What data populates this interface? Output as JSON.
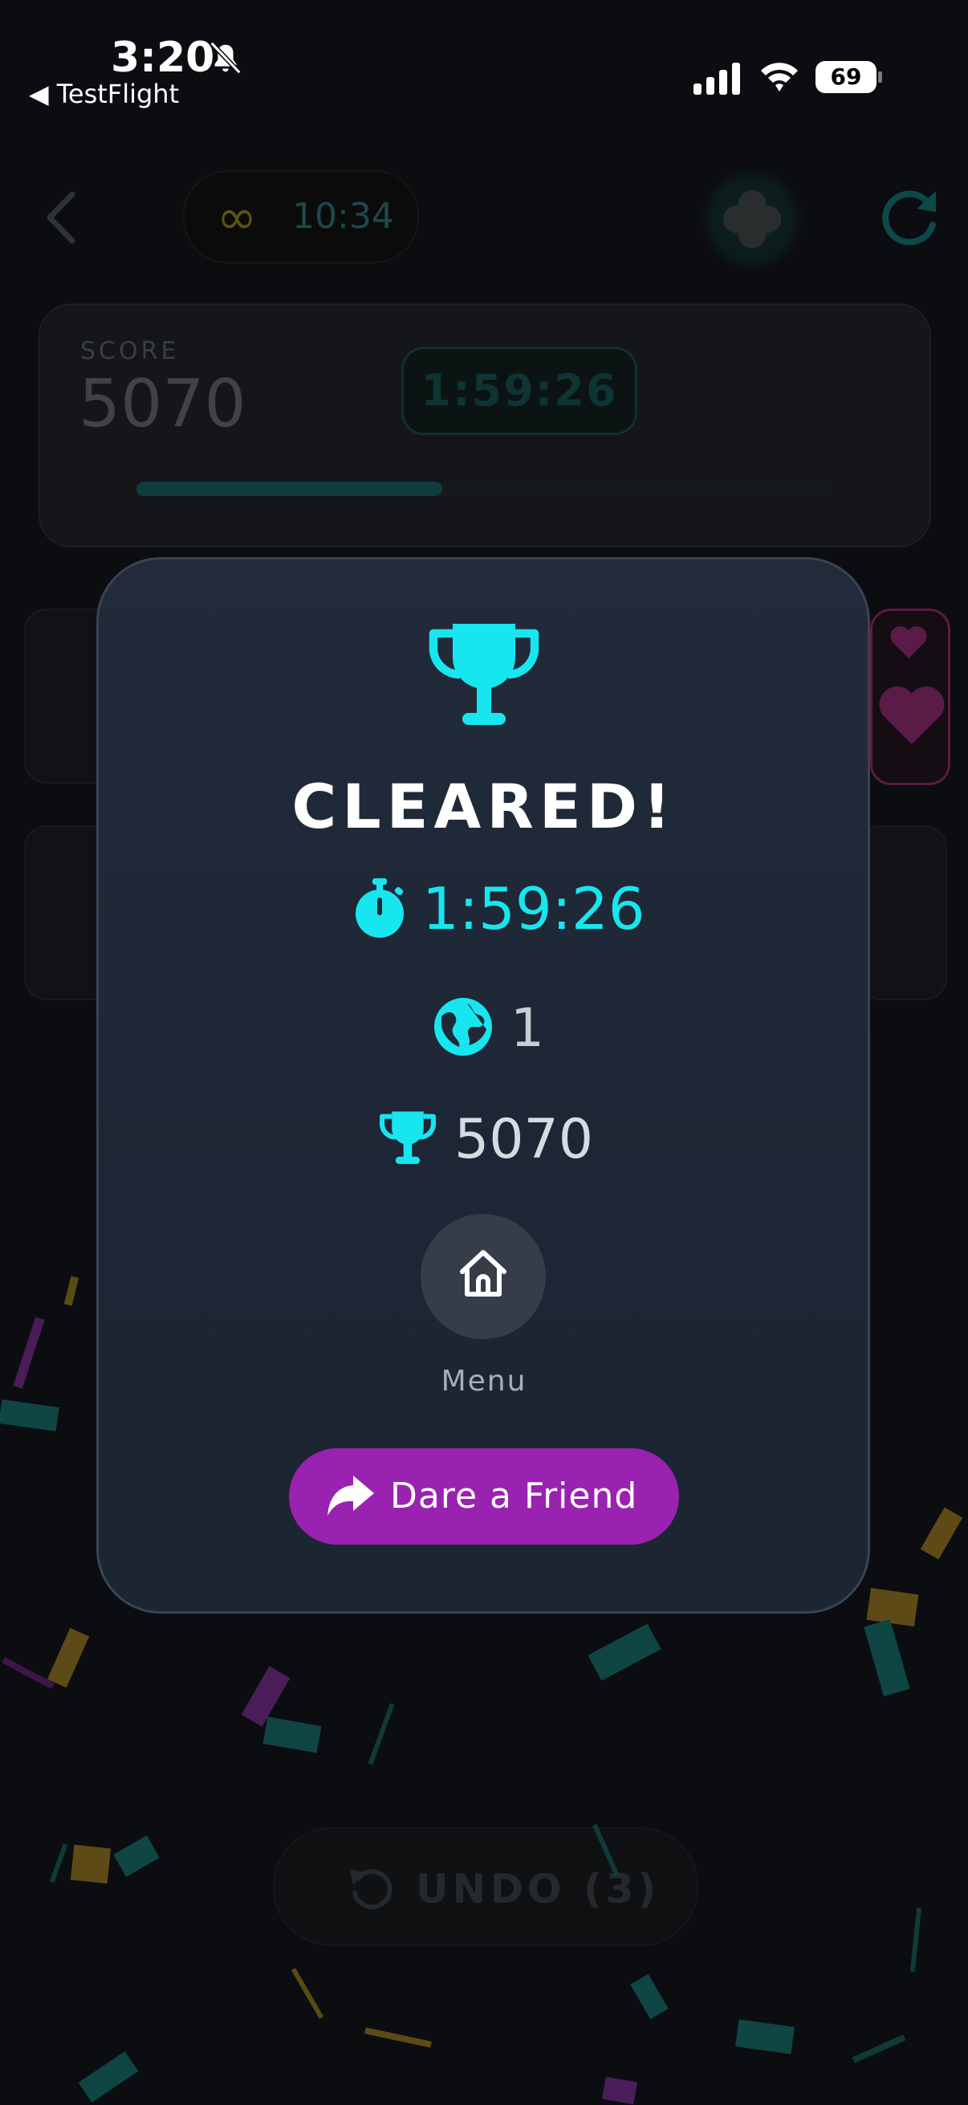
{
  "status_bar": {
    "time": "3:20",
    "back_app": "◀ TestFlight",
    "battery": "69",
    "icons": [
      "bell-slash-icon",
      "signal-icon",
      "wifi-icon",
      "battery-icon"
    ]
  },
  "game": {
    "timer_symbol": "∞",
    "timer": "10:34",
    "score_label": "SCORE",
    "score": "5070",
    "elapsed": "1:59:26",
    "progress": 0.44,
    "undo_label": "UNDO (3)",
    "icons": [
      "back-chevron-icon",
      "infinity-icon",
      "clover-icon",
      "refresh-icon",
      "heart-icon",
      "undo-icon"
    ]
  },
  "modal": {
    "title": "CLEARED!",
    "time": "1:59:26",
    "rank": "1",
    "score": "5070",
    "menu_label": "Menu",
    "dare_label": "Dare a Friend",
    "icons": [
      "trophy-icon",
      "stopwatch-icon",
      "globe-icon",
      "home-icon",
      "share-arrow-icon"
    ]
  },
  "colors": {
    "accent_cyan": "#18e6ef",
    "dare_purple": "#9a22b0",
    "modal_bg": "#1f2836",
    "page_bg": "#0b0d10"
  }
}
